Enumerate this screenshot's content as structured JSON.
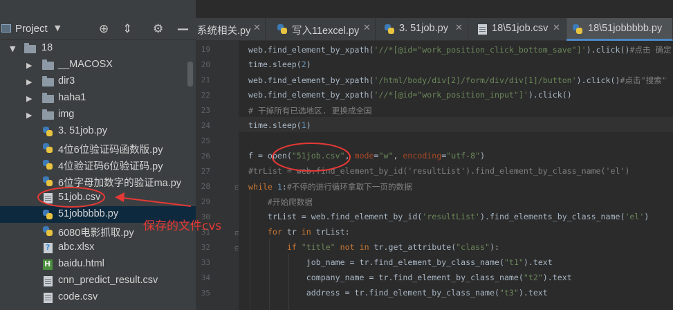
{
  "project_panel": {
    "title": "Project",
    "toolbar_icons": [
      "crosshair-icon",
      "collapse-icon",
      "gear-icon",
      "minimize-icon"
    ]
  },
  "tree": [
    {
      "label": "18",
      "icon": "folder-icon",
      "expanded": true
    },
    {
      "label": "__MACOSX",
      "icon": "folder-icon",
      "expanded": false
    },
    {
      "label": "dir3",
      "icon": "folder-icon",
      "expanded": false
    },
    {
      "label": "haha1",
      "icon": "folder-icon",
      "expanded": false
    },
    {
      "label": "img",
      "icon": "folder-icon",
      "expanded": false
    },
    {
      "label": "3. 51job.py",
      "icon": "python-file-icon"
    },
    {
      "label": "4位6位验证码函数版.py",
      "icon": "python-file-icon"
    },
    {
      "label": "4位验证码6位验证码.py",
      "icon": "python-file-icon"
    },
    {
      "label": "6位字母加数字的验证ma.py",
      "icon": "python-file-icon"
    },
    {
      "label": "51job.csv",
      "icon": "csv-file-icon"
    },
    {
      "label": "51jobbbbb.py",
      "icon": "python-file-icon",
      "selected": true
    },
    {
      "label": "6080电影抓取.py",
      "icon": "python-file-icon"
    },
    {
      "label": "abc.xlsx",
      "icon": "unknown-file-icon"
    },
    {
      "label": "baidu.html",
      "icon": "html-file-icon"
    },
    {
      "label": "cnn_predict_result.csv",
      "icon": "csv-file-icon"
    },
    {
      "label": "code.csv",
      "icon": "csv-file-icon"
    }
  ],
  "tabs": [
    {
      "label": "系统相关.py",
      "icon": "none",
      "active": false
    },
    {
      "label": "写入11excel.py",
      "icon": "python-file-icon",
      "active": false
    },
    {
      "label": "3. 51job.py",
      "icon": "python-file-icon",
      "active": false
    },
    {
      "label": "18\\51job.csv",
      "icon": "csv-file-icon",
      "active": false
    },
    {
      "label": "18\\51jobbbbb.py",
      "icon": "python-file-icon",
      "active": true
    }
  ],
  "editor": {
    "current_line": 24,
    "lines": [
      {
        "no": "19",
        "text": "web.find_element_by_xpath('//*[@id=\"work_position_click_bottom_save\"]').click()#点击 确定"
      },
      {
        "no": "20",
        "text": "time.sleep(2)"
      },
      {
        "no": "21",
        "text": "web.find_element_by_xpath('/html/body/div[2]/form/div/div[1]/button').click()#点击\"搜索\""
      },
      {
        "no": "22",
        "text": "web.find_element_by_xpath('//*[@id=\"work_position_input\"]').click()"
      },
      {
        "no": "23",
        "text": "# 干掉所有已选地区. 更换成全国"
      },
      {
        "no": "24",
        "text": "time.sleep(1)"
      },
      {
        "no": "25",
        "text": ""
      },
      {
        "no": "26",
        "text": "f = open(\"51job.csv\", mode=\"w\", encoding=\"utf-8\")"
      },
      {
        "no": "27",
        "text": "#trList = web.find_element_by_id('resultList').find_element_by_class_name('el')"
      },
      {
        "no": "28",
        "text": "while 1:#不停的进行循环拿取下一页的数据"
      },
      {
        "no": "29",
        "text": "    #开始爬数据"
      },
      {
        "no": "30",
        "text": "    trList = web.find_element_by_id('resultList').find_elements_by_class_name('el')"
      },
      {
        "no": "31",
        "text": "    for tr in trList:"
      },
      {
        "no": "32",
        "text": "        if \"title\" not in tr.get_attribute(\"class\"):"
      },
      {
        "no": "33",
        "text": "            job_name = tr.find_element_by_class_name(\"t1\").text"
      },
      {
        "no": "34",
        "text": "            company_name = tr.find_element_by_class_name(\"t2\").text"
      },
      {
        "no": "35",
        "text": "            address = tr.find_element_by_class_name(\"t3\").text"
      }
    ]
  },
  "annotation": {
    "text": "保存的文件cvs",
    "color": "#e53935"
  },
  "colors": {
    "panel_bg": "#3c3f41",
    "editor_bg": "#2b2b2b",
    "selection": "#0d293e",
    "accent_tab": "#4a88c7"
  }
}
